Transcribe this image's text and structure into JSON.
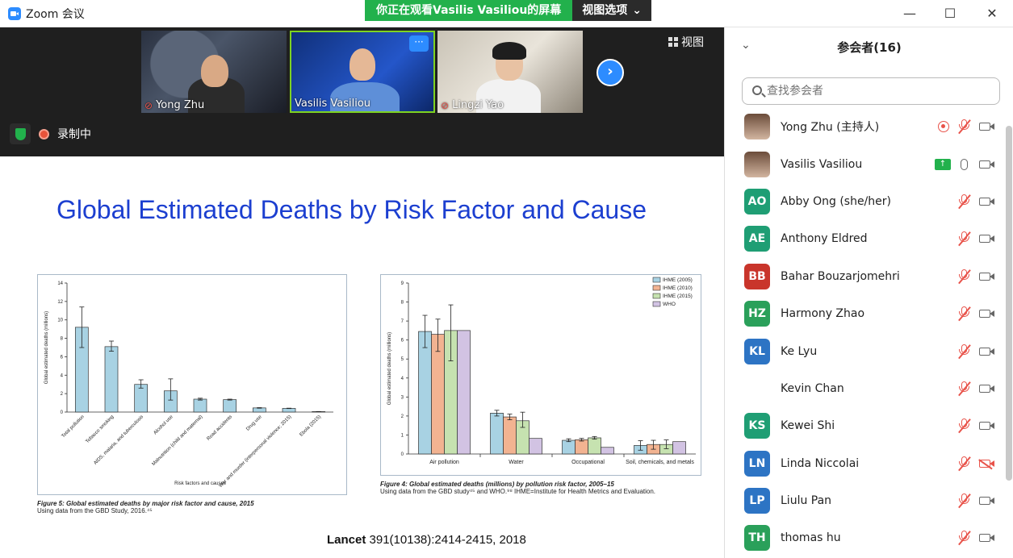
{
  "window": {
    "app_title": "Zoom 会议",
    "share_banner": "你正在观看Vasilis Vasiliou的屏幕",
    "view_options": "视图选项",
    "minimize": "—",
    "maximize": "☐",
    "close": "✕"
  },
  "meeting": {
    "tiles": [
      {
        "name": "Yong Zhu",
        "muted": true
      },
      {
        "name": "Vasilis Vasiliou",
        "muted": false
      },
      {
        "name": "Lingzi Yao",
        "muted": true
      }
    ],
    "more_label": "···",
    "next_label": "›",
    "view_label": "视图",
    "recording_label": "录制中"
  },
  "slide": {
    "title": "Global Estimated Deaths by Risk Factor and Cause",
    "citation_journal": "Lancet",
    "citation_rest": " 391(10138):2414-2415, 2018",
    "fig5_caption_title": "Figure 5: Global estimated deaths by major risk factor and cause, 2015",
    "fig5_caption_sub": "Using data from the GBD Study, 2016.⁴⁵",
    "fig4_caption_title": "Figure 4: Global estimated deaths (millions) by pollution risk factor, 2005–15",
    "fig4_caption_sub": "Using data from the GBD study⁴⁵ and WHO.⁹⁸ IHME=Institute for Health Metrics and Evaluation."
  },
  "chart_data": [
    {
      "type": "bar",
      "ylabel": "Global estimated deaths (millions)",
      "xlabel": "Risk factors and causes",
      "ylim": [
        0,
        14
      ],
      "yticks": [
        0,
        2,
        4,
        6,
        8,
        10,
        12,
        14
      ],
      "categories": [
        "Total pollution",
        "Tobacco smoking",
        "AIDS, malaria, and tuberculosis",
        "Alcohol use",
        "Malnutrition (child and maternal)",
        "Road accidents",
        "Drug use",
        "War and murder (interpersonal violence; 2015)",
        "Ebola (2015)"
      ],
      "values": [
        9.2,
        7.1,
        3.0,
        2.3,
        1.4,
        1.35,
        0.45,
        0.4,
        0.05
      ],
      "errors": [
        [
          7.0,
          11.4
        ],
        [
          6.6,
          7.7
        ],
        [
          2.6,
          3.5
        ],
        [
          1.3,
          3.6
        ],
        [
          1.3,
          1.5
        ],
        [
          1.3,
          1.4
        ],
        [
          0.42,
          0.48
        ],
        [
          0.38,
          0.42
        ],
        [
          0.04,
          0.06
        ]
      ],
      "color": "#a8d2e3"
    },
    {
      "type": "bar",
      "ylabel": "Global estimated deaths (millions)",
      "ylim": [
        0,
        9
      ],
      "yticks": [
        0,
        1,
        2,
        3,
        4,
        5,
        6,
        7,
        8,
        9
      ],
      "categories": [
        "Air pollution",
        "Water",
        "Occupational",
        "Soil, chemicals, and metals"
      ],
      "series": [
        {
          "name": "IHME (2005)",
          "color": "#a8d2e3",
          "values": [
            6.45,
            2.15,
            0.72,
            0.45
          ],
          "errors": [
            [
              5.6,
              7.3
            ],
            [
              2.0,
              2.3
            ],
            [
              0.65,
              0.8
            ],
            [
              0.2,
              0.7
            ]
          ]
        },
        {
          "name": "IHME (2010)",
          "color": "#f2b391",
          "values": [
            6.3,
            1.95,
            0.75,
            0.5
          ],
          "errors": [
            [
              5.4,
              7.1
            ],
            [
              1.8,
              2.1
            ],
            [
              0.68,
              0.82
            ],
            [
              0.25,
              0.72
            ]
          ]
        },
        {
          "name": "IHME (2015)",
          "color": "#c6e2b0",
          "values": [
            6.5,
            1.75,
            0.85,
            0.5
          ],
          "errors": [
            [
              4.9,
              7.85
            ],
            [
              1.4,
              2.2
            ],
            [
              0.78,
              0.92
            ],
            [
              0.28,
              0.74
            ]
          ]
        },
        {
          "name": "WHO",
          "color": "#d2c3e3",
          "values": [
            6.5,
            0.82,
            0.35,
            0.65
          ],
          "errors": null
        }
      ]
    }
  ],
  "participants": {
    "header": "参会者(16)",
    "search_placeholder": "查找参会者",
    "list": [
      {
        "initials": "",
        "name": "Yong Zhu (主持人)",
        "color": "",
        "photo": true,
        "muted": true,
        "cam_off": false,
        "rec": true,
        "share": false
      },
      {
        "initials": "",
        "name": "Vasilis Vasiliou",
        "color": "",
        "photo": true,
        "muted": false,
        "cam_off": false,
        "rec": false,
        "share": true
      },
      {
        "initials": "AO",
        "name": "Abby Ong (she/her)",
        "color": "#1f9e74",
        "photo": false,
        "muted": true,
        "cam_off": false,
        "rec": false,
        "share": false
      },
      {
        "initials": "AE",
        "name": "Anthony Eldred",
        "color": "#1f9e74",
        "photo": false,
        "muted": true,
        "cam_off": false,
        "rec": false,
        "share": false
      },
      {
        "initials": "BB",
        "name": "Bahar Bouzarjomehri",
        "color": "#c9352b",
        "photo": false,
        "muted": true,
        "cam_off": false,
        "rec": false,
        "share": false
      },
      {
        "initials": "HZ",
        "name": "Harmony Zhao",
        "color": "#2aa05a",
        "photo": false,
        "muted": true,
        "cam_off": false,
        "rec": false,
        "share": false
      },
      {
        "initials": "KL",
        "name": "Ke Lyu",
        "color": "#2d74c4",
        "photo": false,
        "muted": true,
        "cam_off": false,
        "rec": false,
        "share": false
      },
      {
        "initials": "",
        "name": "Kevin Chan",
        "color": "",
        "photo": false,
        "muted": true,
        "cam_off": false,
        "rec": false,
        "share": false
      },
      {
        "initials": "KS",
        "name": "Kewei Shi",
        "color": "#1f9e74",
        "photo": false,
        "muted": true,
        "cam_off": false,
        "rec": false,
        "share": false
      },
      {
        "initials": "LN",
        "name": "Linda Niccolai",
        "color": "#2d74c4",
        "photo": false,
        "muted": true,
        "cam_off": true,
        "rec": false,
        "share": false
      },
      {
        "initials": "LP",
        "name": "Liulu Pan",
        "color": "#2d74c4",
        "photo": false,
        "muted": true,
        "cam_off": false,
        "rec": false,
        "share": false
      },
      {
        "initials": "TH",
        "name": "thomas hu",
        "color": "#2aa05a",
        "photo": false,
        "muted": true,
        "cam_off": false,
        "rec": false,
        "share": false
      }
    ]
  }
}
